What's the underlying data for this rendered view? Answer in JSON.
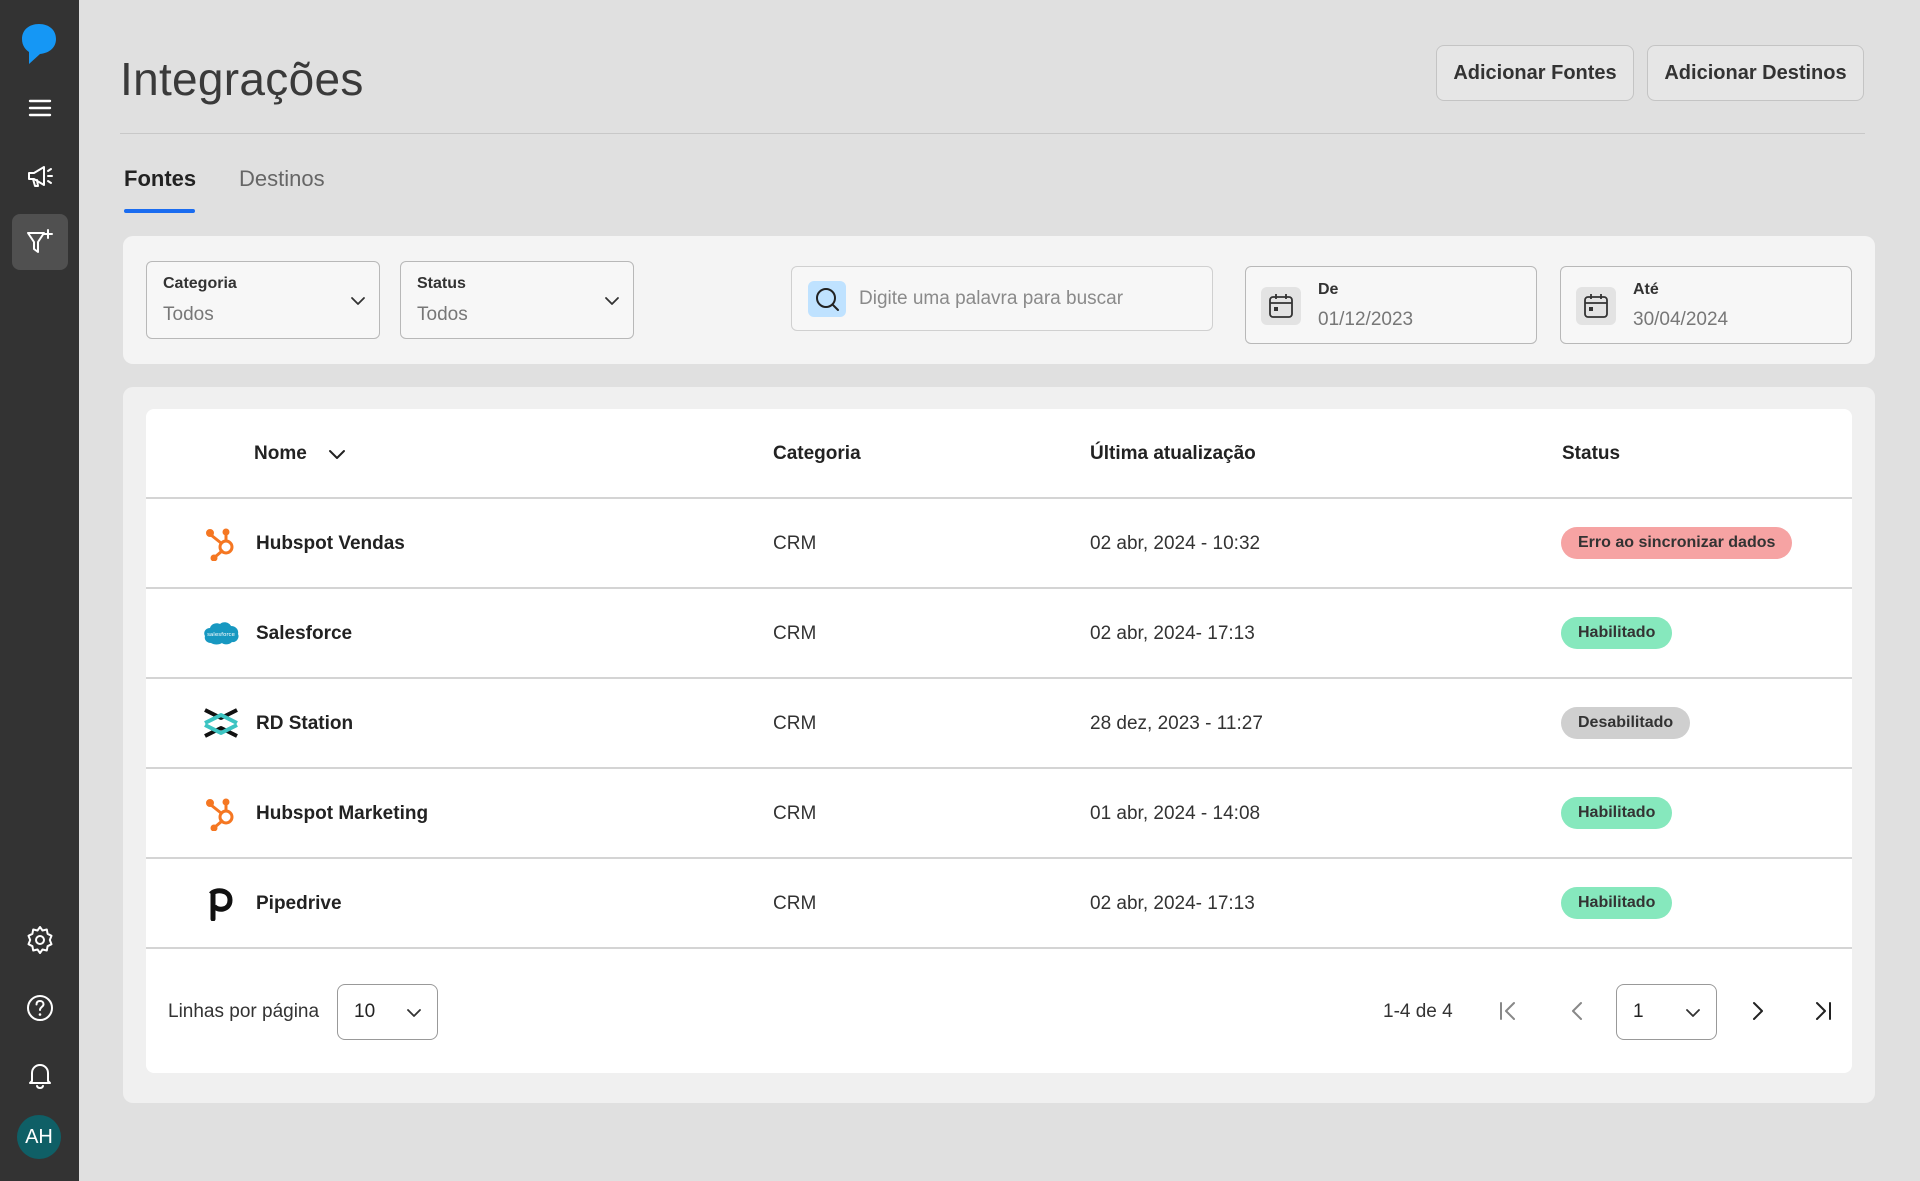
{
  "sidebar": {
    "items": [
      {
        "name": "menu-icon"
      },
      {
        "name": "megaphone-icon"
      },
      {
        "name": "filter-add-icon"
      },
      {
        "name": "gear-icon"
      },
      {
        "name": "help-icon"
      },
      {
        "name": "bell-icon"
      }
    ],
    "avatar_initials": "AH"
  },
  "header": {
    "title": "Integrações",
    "add_sources_label": "Adicionar Fontes",
    "add_destinations_label": "Adicionar Destinos"
  },
  "tabs": [
    {
      "label": "Fontes",
      "active": true
    },
    {
      "label": "Destinos",
      "active": false
    }
  ],
  "filters": {
    "category": {
      "label": "Categoria",
      "value": "Todos"
    },
    "status": {
      "label": "Status",
      "value": "Todos"
    },
    "search": {
      "placeholder": "Digite uma palavra para buscar"
    },
    "date_from": {
      "label": "De",
      "value": "01/12/2023"
    },
    "date_to": {
      "label": "Até",
      "value": "30/04/2024"
    }
  },
  "table": {
    "columns": [
      "Nome",
      "Categoria",
      "Última atualização",
      "Status"
    ],
    "rows": [
      {
        "name": "Hubspot Vendas",
        "icon": "hubspot-icon",
        "category": "CRM",
        "updated": "02 abr, 2024 - 10:32",
        "status": "Erro ao sincronizar dados",
        "status_color": "#f6a3a3"
      },
      {
        "name": "Salesforce",
        "icon": "salesforce-icon",
        "category": "CRM",
        "updated": "02 abr, 2024- 17:13",
        "status": "Habilitado",
        "status_color": "#86e8bd"
      },
      {
        "name": "RD Station",
        "icon": "rdstation-icon",
        "category": "CRM",
        "updated": "28 dez, 2023 - 11:27",
        "status": "Desabilitado",
        "status_color": "#cfcfcf"
      },
      {
        "name": "Hubspot Marketing",
        "icon": "hubspot-icon",
        "category": "CRM",
        "updated": "01 abr, 2024 - 14:08",
        "status": "Habilitado",
        "status_color": "#86e8bd"
      },
      {
        "name": "Pipedrive",
        "icon": "pipedrive-icon",
        "category": "CRM",
        "updated": "02 abr, 2024- 17:13",
        "status": "Habilitado",
        "status_color": "#86e8bd"
      }
    ]
  },
  "pagination": {
    "rows_per_page_label": "Linhas por página",
    "rows_per_page_value": "10",
    "range_text": "1-4 de 4",
    "page_value": "1"
  },
  "colors": {
    "accent": "#1a6cf0",
    "sidebar_bg": "#333333",
    "logo": "#1597f5",
    "avatar_bg": "#0f5f66",
    "hubspot": "#f57722",
    "salesforce": "#1798c1"
  }
}
